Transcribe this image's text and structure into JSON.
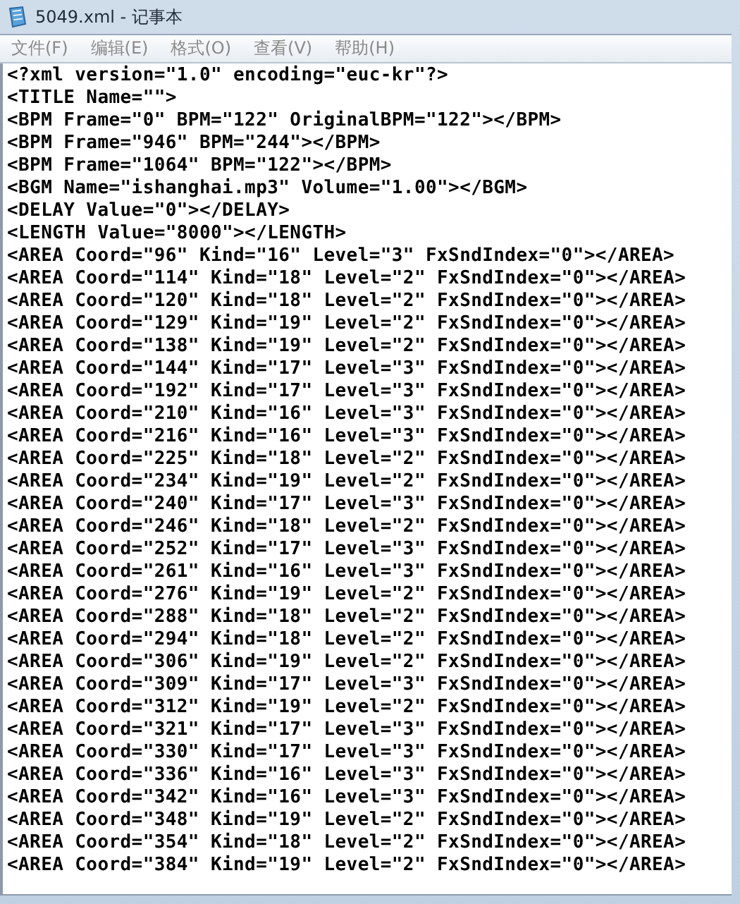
{
  "window": {
    "title": "5049.xml - 记事本"
  },
  "menu": [
    "文件(F)",
    "编辑(E)",
    "格式(O)",
    "查看(V)",
    "帮助(H)"
  ],
  "lines": [
    "<?xml version=\"1.0\" encoding=\"euc-kr\"?>",
    "<TITLE Name=\"\">",
    "<BPM Frame=\"0\" BPM=\"122\" OriginalBPM=\"122\"></BPM>",
    "<BPM Frame=\"946\" BPM=\"244\"></BPM>",
    "<BPM Frame=\"1064\" BPM=\"122\"></BPM>",
    "<BGM Name=\"ishanghai.mp3\" Volume=\"1.00\"></BGM>",
    "<DELAY Value=\"0\"></DELAY>",
    "<LENGTH Value=\"8000\"></LENGTH>",
    "<AREA Coord=\"96\" Kind=\"16\" Level=\"3\" FxSndIndex=\"0\"></AREA>",
    "<AREA Coord=\"114\" Kind=\"18\" Level=\"2\" FxSndIndex=\"0\"></AREA>",
    "<AREA Coord=\"120\" Kind=\"18\" Level=\"2\" FxSndIndex=\"0\"></AREA>",
    "<AREA Coord=\"129\" Kind=\"19\" Level=\"2\" FxSndIndex=\"0\"></AREA>",
    "<AREA Coord=\"138\" Kind=\"19\" Level=\"2\" FxSndIndex=\"0\"></AREA>",
    "<AREA Coord=\"144\" Kind=\"17\" Level=\"3\" FxSndIndex=\"0\"></AREA>",
    "<AREA Coord=\"192\" Kind=\"17\" Level=\"3\" FxSndIndex=\"0\"></AREA>",
    "<AREA Coord=\"210\" Kind=\"16\" Level=\"3\" FxSndIndex=\"0\"></AREA>",
    "<AREA Coord=\"216\" Kind=\"16\" Level=\"3\" FxSndIndex=\"0\"></AREA>",
    "<AREA Coord=\"225\" Kind=\"18\" Level=\"2\" FxSndIndex=\"0\"></AREA>",
    "<AREA Coord=\"234\" Kind=\"19\" Level=\"2\" FxSndIndex=\"0\"></AREA>",
    "<AREA Coord=\"240\" Kind=\"17\" Level=\"3\" FxSndIndex=\"0\"></AREA>",
    "<AREA Coord=\"246\" Kind=\"18\" Level=\"2\" FxSndIndex=\"0\"></AREA>",
    "<AREA Coord=\"252\" Kind=\"17\" Level=\"3\" FxSndIndex=\"0\"></AREA>",
    "<AREA Coord=\"261\" Kind=\"16\" Level=\"3\" FxSndIndex=\"0\"></AREA>",
    "<AREA Coord=\"276\" Kind=\"19\" Level=\"2\" FxSndIndex=\"0\"></AREA>",
    "<AREA Coord=\"288\" Kind=\"18\" Level=\"2\" FxSndIndex=\"0\"></AREA>",
    "<AREA Coord=\"294\" Kind=\"18\" Level=\"2\" FxSndIndex=\"0\"></AREA>",
    "<AREA Coord=\"306\" Kind=\"19\" Level=\"2\" FxSndIndex=\"0\"></AREA>",
    "<AREA Coord=\"309\" Kind=\"17\" Level=\"3\" FxSndIndex=\"0\"></AREA>",
    "<AREA Coord=\"312\" Kind=\"19\" Level=\"2\" FxSndIndex=\"0\"></AREA>",
    "<AREA Coord=\"321\" Kind=\"17\" Level=\"3\" FxSndIndex=\"0\"></AREA>",
    "<AREA Coord=\"330\" Kind=\"17\" Level=\"3\" FxSndIndex=\"0\"></AREA>",
    "<AREA Coord=\"336\" Kind=\"16\" Level=\"3\" FxSndIndex=\"0\"></AREA>",
    "<AREA Coord=\"342\" Kind=\"16\" Level=\"3\" FxSndIndex=\"0\"></AREA>",
    "<AREA Coord=\"348\" Kind=\"19\" Level=\"2\" FxSndIndex=\"0\"></AREA>",
    "<AREA Coord=\"354\" Kind=\"18\" Level=\"2\" FxSndIndex=\"0\"></AREA>",
    "<AREA Coord=\"384\" Kind=\"19\" Level=\"2\" FxSndIndex=\"0\"></AREA>"
  ]
}
